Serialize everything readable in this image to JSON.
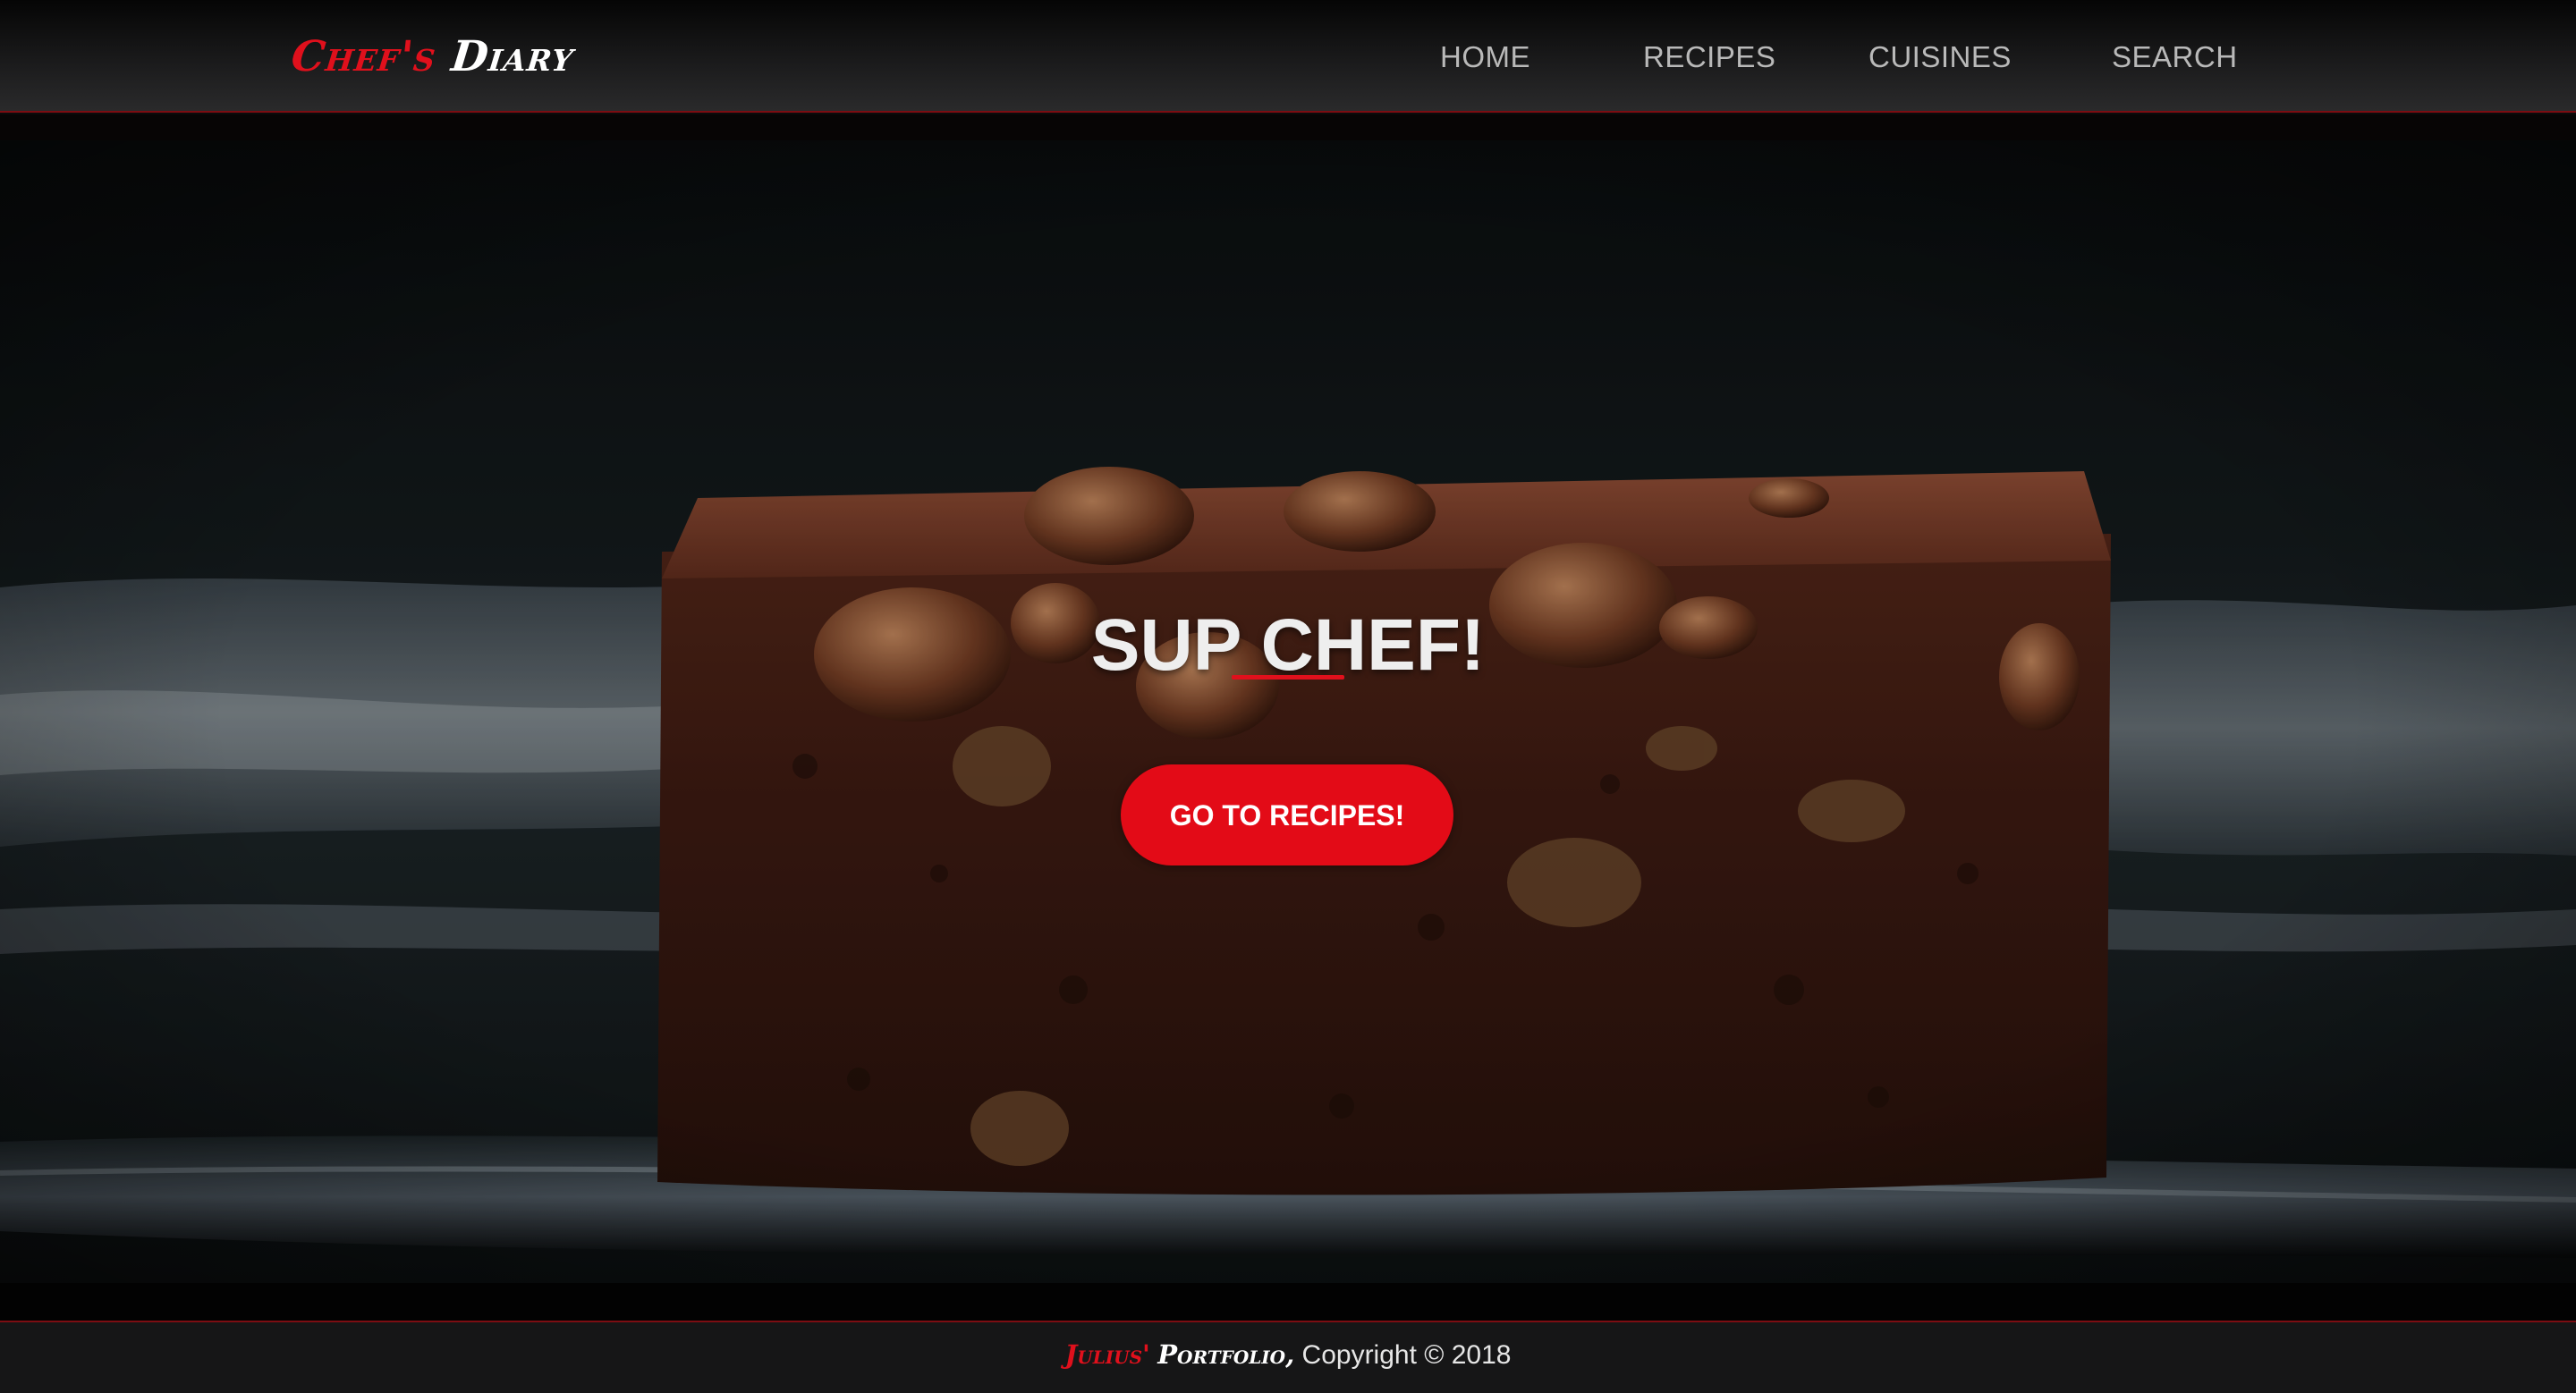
{
  "header": {
    "brand_part1": "Chef's",
    "brand_part2": "Diary",
    "nav": [
      {
        "label": "HOME"
      },
      {
        "label": "RECIPES"
      },
      {
        "label": "CUISINES"
      },
      {
        "label": "SEARCH"
      }
    ]
  },
  "hero": {
    "title": "SUP CHEF!",
    "cta_label": "GO TO RECIPES!",
    "background_image": "brownie-with-walnuts-photo"
  },
  "footer": {
    "name": "Julius'",
    "portfolio": "Portfolio,",
    "copyright": "Copyright © 2018"
  },
  "colors": {
    "accent": "#e30b17",
    "header_bg": "#1c1c1d",
    "footer_bg": "#161617",
    "nav_text": "#b9b9b9"
  }
}
